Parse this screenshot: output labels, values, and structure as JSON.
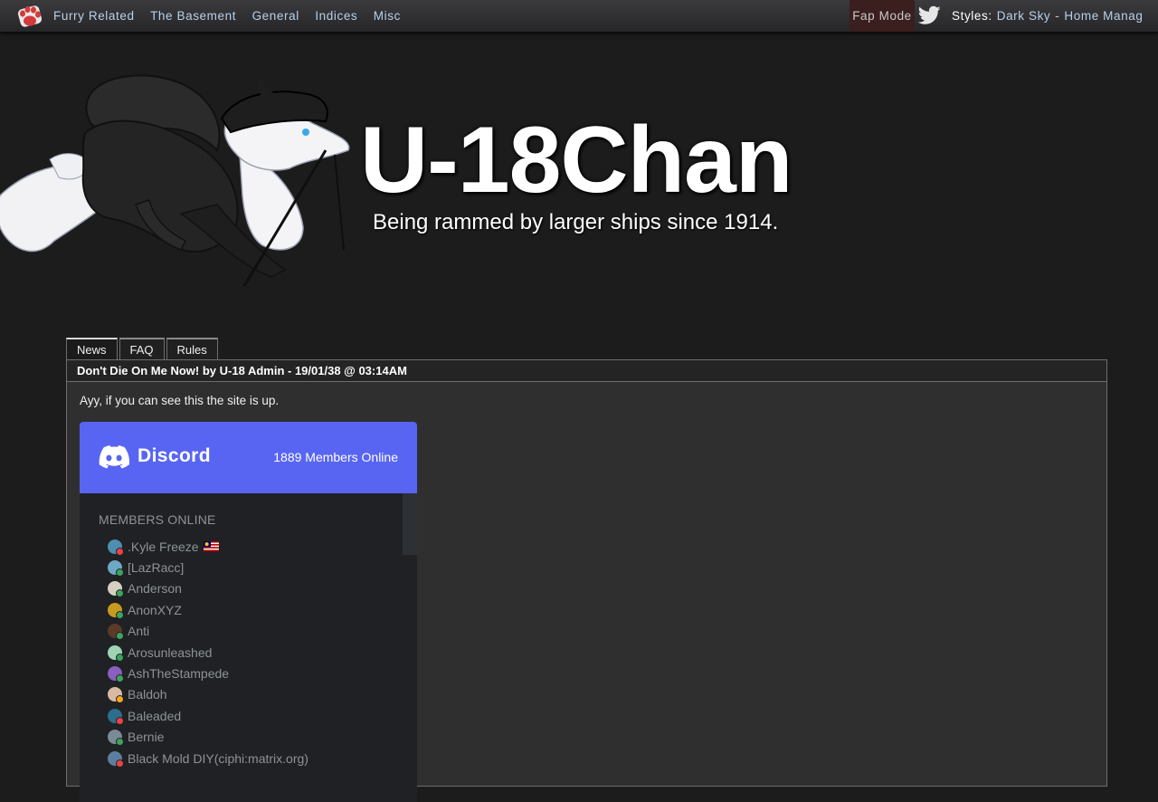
{
  "topbar": {
    "nav": [
      "Furry Related",
      "The Basement",
      "General",
      "Indices",
      "Misc"
    ],
    "fap_mode": "Fap Mode",
    "styles_label": "Styles:",
    "styles_value": "Dark Sky",
    "styles_separator": "-",
    "home_manage": "Home Manag",
    "logo_icon": "paw-logo-icon",
    "twitter_icon": "twitter-bird-icon"
  },
  "banner": {
    "title": "U-18Chan",
    "tagline": "Being rammed by larger ships since 1914."
  },
  "tabs": [
    "News",
    "FAQ",
    "Rules"
  ],
  "news": {
    "heading": "Don't Die On Me Now! by U-18 Admin - 19/01/38 @ 03:14AM",
    "body": "Ayy, if you can see this the site is up."
  },
  "discord": {
    "brand": "Discord",
    "members_online_count": "1889 Members Online",
    "section_title": "MEMBERS ONLINE",
    "members": [
      {
        "name": ".Kyle Freeze",
        "avatar_color": "#4d8fb0",
        "status_color": "#ed4245",
        "flag": "flag-icon"
      },
      {
        "name": "[LazRacc]",
        "avatar_color": "#6fa7c4",
        "status_color": "#3ba55c"
      },
      {
        "name": "Anderson",
        "avatar_color": "#d6d0c2",
        "status_color": "#3ba55c"
      },
      {
        "name": "AnonXYZ",
        "avatar_color": "#c89a1e",
        "status_color": "#3ba55c"
      },
      {
        "name": "Anti",
        "avatar_color": "#5a3a28",
        "status_color": "#3ba55c"
      },
      {
        "name": "Arosunleashed",
        "avatar_color": "#9fd4b5",
        "status_color": "#3ba55c"
      },
      {
        "name": "AshTheStampede",
        "avatar_color": "#8a5fbf",
        "status_color": "#3ba55c"
      },
      {
        "name": "Baldoh",
        "avatar_color": "#d8b9a3",
        "status_color": "#faa61a"
      },
      {
        "name": "Baleaded",
        "avatar_color": "#2b6e8e",
        "status_color": "#ed4245"
      },
      {
        "name": "Bernie",
        "avatar_color": "#7a8a96",
        "status_color": "#3ba55c"
      },
      {
        "name": "Black Mold DIY(ciphi:matrix.org)",
        "avatar_color": "#5c7fa0",
        "status_color": "#ed4245"
      }
    ]
  },
  "colors": {
    "background": "#1c1c1d",
    "nav_link": "#b9d0e8",
    "discord_blurple": "#5865f2"
  }
}
